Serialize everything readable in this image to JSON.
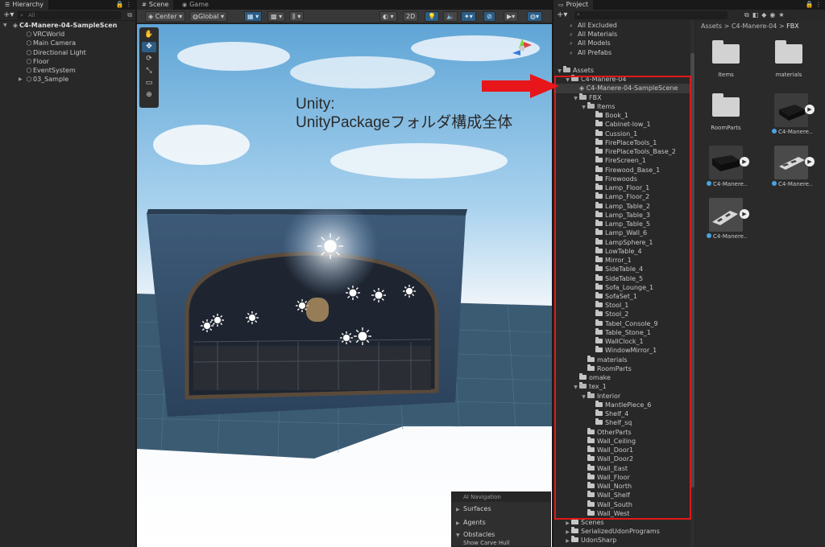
{
  "hierarchy": {
    "tab": "Hierarchy",
    "search_placeholder": "All",
    "items": [
      {
        "label": "C4-Manere-04-SampleScen",
        "icon": "unity-scene-icon",
        "arrow": "▼"
      },
      {
        "label": "VRCWorld",
        "icon": "cube-icon"
      },
      {
        "label": "Main Camera",
        "icon": "cube-icon"
      },
      {
        "label": "Directional Light",
        "icon": "cube-icon"
      },
      {
        "label": "Floor",
        "icon": "cube-icon"
      },
      {
        "label": "EventSystem",
        "icon": "cube-icon"
      },
      {
        "label": "03_Sample",
        "icon": "cube-icon",
        "arrow": "▶"
      }
    ]
  },
  "scene": {
    "tabs": [
      "Scene",
      "Game"
    ],
    "toolbar": {
      "center": "Center",
      "global": "Global",
      "mode_2d": "2D"
    },
    "annotation": {
      "line1": "Unity:",
      "line2": "UnityPackageフォルダ構成全体"
    },
    "ai_navigation": {
      "title": "AI Navigation",
      "sections": [
        "Surfaces",
        "Agents",
        "Obstacles"
      ],
      "sub": "Show Carve Hull"
    }
  },
  "project": {
    "tab": "Project",
    "favorites": [
      "All Excluded",
      "All Materials",
      "All Models",
      "All Prefabs"
    ],
    "breadcrumb": [
      "Assets",
      "C4-Manere-04",
      "FBX"
    ],
    "tree": [
      {
        "label": "Assets",
        "depth": 0,
        "arrow": "▼",
        "open": true
      },
      {
        "label": "C4-Manere-04",
        "depth": 1,
        "arrow": "▼",
        "open": true
      },
      {
        "label": "C4-Manere-04-SampleScene",
        "depth": 2,
        "scene": true,
        "selected": true
      },
      {
        "label": "FBX",
        "depth": 2,
        "arrow": "▼",
        "open": true
      },
      {
        "label": "Items",
        "depth": 3,
        "arrow": "▼",
        "open": true
      },
      {
        "label": "Book_1",
        "depth": 4
      },
      {
        "label": "Cabinet-low_1",
        "depth": 4
      },
      {
        "label": "Cussion_1",
        "depth": 4
      },
      {
        "label": "FirePlaceTools_1",
        "depth": 4
      },
      {
        "label": "FirePlaceTools_Base_2",
        "depth": 4
      },
      {
        "label": "FireScreen_1",
        "depth": 4
      },
      {
        "label": "Firewood_Base_1",
        "depth": 4
      },
      {
        "label": "Firewoods",
        "depth": 4
      },
      {
        "label": "Lamp_Floor_1",
        "depth": 4
      },
      {
        "label": "Lamp_Floor_2",
        "depth": 4
      },
      {
        "label": "Lamp_Table_2",
        "depth": 4
      },
      {
        "label": "Lamp_Table_3",
        "depth": 4
      },
      {
        "label": "Lamp_Table_5",
        "depth": 4
      },
      {
        "label": "Lamp_Wall_6",
        "depth": 4
      },
      {
        "label": "LampSphere_1",
        "depth": 4
      },
      {
        "label": "LowTable_4",
        "depth": 4
      },
      {
        "label": "Mirror_1",
        "depth": 4
      },
      {
        "label": "SideTable_4",
        "depth": 4
      },
      {
        "label": "SideTable_5",
        "depth": 4
      },
      {
        "label": "Sofa_Lounge_1",
        "depth": 4
      },
      {
        "label": "SofaSet_1",
        "depth": 4
      },
      {
        "label": "Stool_1",
        "depth": 4
      },
      {
        "label": "Stool_2",
        "depth": 4
      },
      {
        "label": "Tabel_Console_9",
        "depth": 4
      },
      {
        "label": "Table_Stone_1",
        "depth": 4
      },
      {
        "label": "WallClock_1",
        "depth": 4
      },
      {
        "label": "WindowMirror_1",
        "depth": 4
      },
      {
        "label": "materials",
        "depth": 3
      },
      {
        "label": "RoomParts",
        "depth": 3
      },
      {
        "label": "omake",
        "depth": 2
      },
      {
        "label": "tex_1",
        "depth": 2,
        "arrow": "▼",
        "open": true
      },
      {
        "label": "Interior",
        "depth": 3,
        "arrow": "▼",
        "open": true
      },
      {
        "label": "MantlePiece_6",
        "depth": 4
      },
      {
        "label": "Shelf_4",
        "depth": 4
      },
      {
        "label": "Shelf_sq",
        "depth": 4
      },
      {
        "label": "OtherParts",
        "depth": 3
      },
      {
        "label": "Wall_Ceiling",
        "depth": 3
      },
      {
        "label": "Wall_Door1",
        "depth": 3
      },
      {
        "label": "Wall_Door2",
        "depth": 3
      },
      {
        "label": "Wall_East",
        "depth": 3
      },
      {
        "label": "Wall_Floor",
        "depth": 3
      },
      {
        "label": "Wall_North",
        "depth": 3
      },
      {
        "label": "Wall_Shelf",
        "depth": 3
      },
      {
        "label": "Wall_South",
        "depth": 3
      },
      {
        "label": "Wall_West",
        "depth": 3
      },
      {
        "label": "Scenes",
        "depth": 1,
        "arrow": "▶"
      },
      {
        "label": "SerializedUdonPrograms",
        "depth": 1,
        "arrow": "▶"
      },
      {
        "label": "UdonSharp",
        "depth": 1,
        "arrow": "▶"
      }
    ],
    "grid": [
      {
        "label": "Items",
        "kind": "folder"
      },
      {
        "label": "materials",
        "kind": "folder"
      },
      {
        "label": "RoomParts",
        "kind": "folder"
      },
      {
        "label": "C4-Manere...",
        "kind": "model"
      },
      {
        "label": "C4-Manere...",
        "kind": "model"
      },
      {
        "label": "C4-Manere...",
        "kind": "model"
      },
      {
        "label": "C4-Manere...",
        "kind": "model"
      }
    ]
  },
  "colors": {
    "highlight": "#e01818",
    "accent": "#2c5d87"
  }
}
